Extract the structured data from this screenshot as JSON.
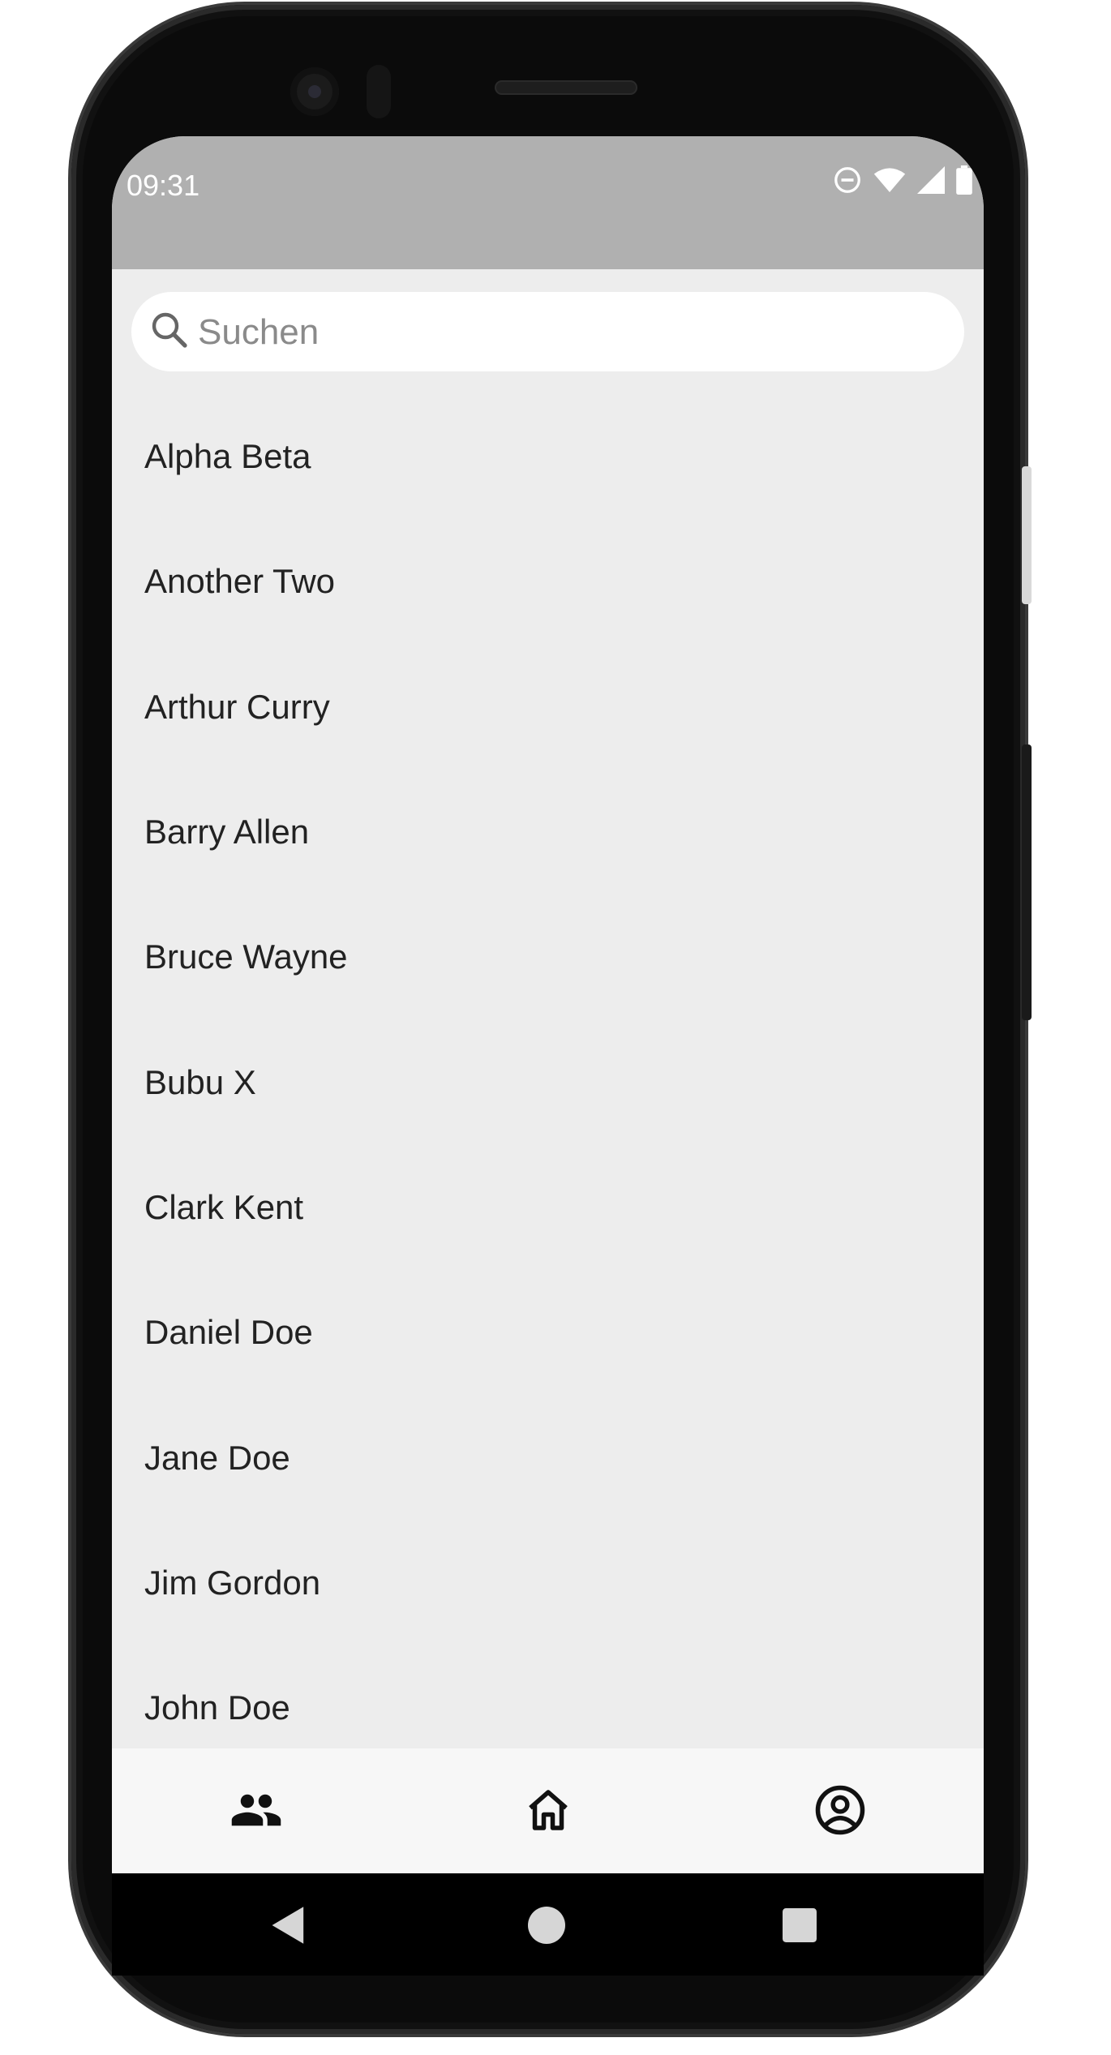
{
  "status_bar": {
    "time": "09:31",
    "icons": [
      "do-not-disturb-icon",
      "wifi-icon",
      "signal-icon",
      "battery-icon"
    ]
  },
  "search": {
    "placeholder": "Suchen"
  },
  "contacts": [
    "Alpha Beta",
    "Another Two",
    "Arthur Curry",
    "Barry Allen",
    "Bruce Wayne",
    "Bubu X",
    "Clark Kent",
    "Daniel Doe",
    "Jane Doe",
    "Jim Gordon",
    "John Doe"
  ],
  "bottom_nav": {
    "items": [
      "people-icon",
      "home-icon",
      "account-circle-icon"
    ]
  },
  "system_nav": {
    "items": [
      "back-icon",
      "home-circle-icon",
      "recents-icon"
    ]
  },
  "colors": {
    "status_bar": "#b0b0b0",
    "background": "#ededed",
    "nav_bar": "#f7f7f7",
    "text": "#222222"
  }
}
